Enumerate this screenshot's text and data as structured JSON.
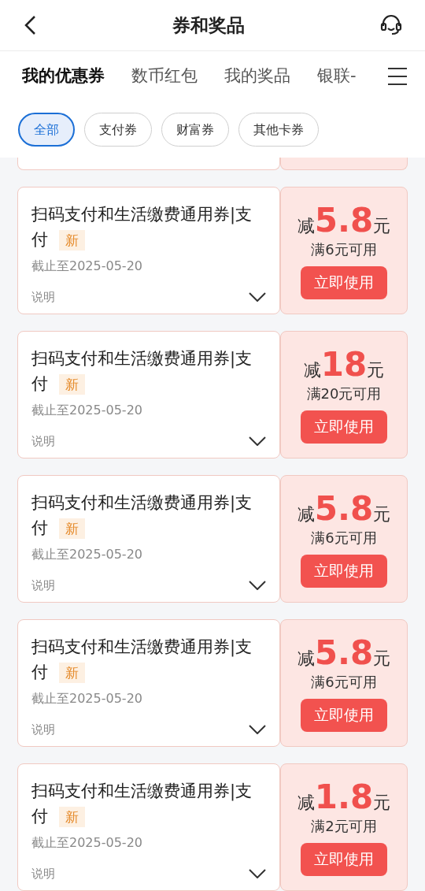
{
  "header": {
    "title": "券和奖品"
  },
  "tabs": [
    {
      "label": "我的优惠券",
      "selected": true
    },
    {
      "label": "数币红包",
      "selected": false
    },
    {
      "label": "我的奖品",
      "selected": false
    },
    {
      "label": "银联-",
      "selected": false
    }
  ],
  "filters": [
    {
      "label": "全部",
      "selected": true
    },
    {
      "label": "支付券",
      "selected": false
    },
    {
      "label": "财富券",
      "selected": false
    },
    {
      "label": "其他卡券",
      "selected": false
    }
  ],
  "coupons": [
    {
      "title": "扫码支付和生活缴费通用券|支付",
      "badge": "新",
      "expiry": "截止至2025-05-20",
      "note": "说明",
      "prefix": "减",
      "amount": "5.8",
      "unit": "元",
      "condition": "满6元可用",
      "button": "立即使用"
    },
    {
      "title": "扫码支付和生活缴费通用券|支付",
      "badge": "新",
      "expiry": "截止至2025-05-20",
      "note": "说明",
      "prefix": "减",
      "amount": "18",
      "unit": "元",
      "condition": "满20元可用",
      "button": "立即使用"
    },
    {
      "title": "扫码支付和生活缴费通用券|支付",
      "badge": "新",
      "expiry": "截止至2025-05-20",
      "note": "说明",
      "prefix": "减",
      "amount": "5.8",
      "unit": "元",
      "condition": "满6元可用",
      "button": "立即使用"
    },
    {
      "title": "扫码支付和生活缴费通用券|支付",
      "badge": "新",
      "expiry": "截止至2025-05-20",
      "note": "说明",
      "prefix": "减",
      "amount": "5.8",
      "unit": "元",
      "condition": "满6元可用",
      "button": "立即使用"
    },
    {
      "title": "扫码支付和生活缴费通用券|支付",
      "badge": "新",
      "expiry": "截止至2025-05-20",
      "note": "说明",
      "prefix": "减",
      "amount": "1.8",
      "unit": "元",
      "condition": "满2元可用",
      "button": "立即使用"
    }
  ]
}
